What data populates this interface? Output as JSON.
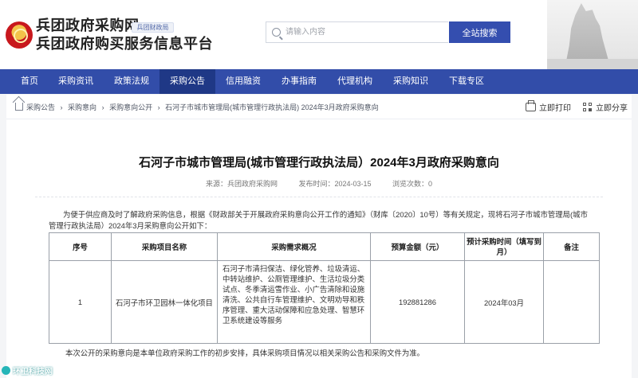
{
  "site": {
    "title_line1": "兵团政府采购网",
    "title_line2": "兵团政府购买服务信息平台",
    "badge": "兵团财政局"
  },
  "search": {
    "placeholder": "请输入内容",
    "button_label": "全站搜索"
  },
  "nav": {
    "items": [
      {
        "label": "首页",
        "active": false
      },
      {
        "label": "采购资讯",
        "active": false
      },
      {
        "label": "政策法规",
        "active": false
      },
      {
        "label": "采购公告",
        "active": true
      },
      {
        "label": "信用融资",
        "active": false
      },
      {
        "label": "办事指南",
        "active": false
      },
      {
        "label": "代理机构",
        "active": false
      },
      {
        "label": "采购知识",
        "active": false
      },
      {
        "label": "下载专区",
        "active": false
      }
    ]
  },
  "breadcrumb": [
    "采购公告",
    "›",
    "采购意向",
    "›",
    "采购意向公开",
    "›",
    "石河子市城市管理局(城市管理行政执法局) 2024年3月政府采购意向"
  ],
  "actions": {
    "print_label": "立即打印",
    "share_label": "立即分享"
  },
  "article": {
    "title": "石河子市城市管理局(城市管理行政执法局）2024年3月政府采购意向",
    "source": "来源：兵团政府采购网",
    "date": "发布时间：2024-03-15",
    "views": "浏览次数：0",
    "intro": "为便于供应商及时了解政府采购信息，根据《财政部关于开展政府采购意向公开工作的通知》（财库〔2020〕10号）等有关规定，现将石河子市城市管理局(城市管理行政执法局）2024年3月采购意向公开如下：",
    "footer_note": "本次公开的采购意向是本单位政府采购工作的初步安排，具体采购项目情况以相关采购公告和采购文件为准。"
  },
  "table": {
    "headers": [
      "序号",
      "采购项目名称",
      "采购需求概况",
      "预算金额（元）",
      "预计采购时间（填写到月）",
      "备注"
    ],
    "rows": [
      {
        "index": "1",
        "project": "石河子市环卫园林一体化项目",
        "description": "石河子市清扫保洁、绿化管养、垃圾清运、中转站维护、公厕管理维护、生活垃圾分类试点、冬季清运雪作业、小广告清除和设施清洗、公共自行车管理维护、文明劝导和秩序管理、重大活动保障和应急处理、智慧环卫系统建设等服务",
        "budget": "192881286",
        "time": "2024年03月",
        "note": ""
      }
    ]
  },
  "bottom_logo": "环卫科技网",
  "colors": {
    "nav_bg": "#324da9",
    "nav_active": "#1f3886",
    "search_button": "#344eaf"
  }
}
